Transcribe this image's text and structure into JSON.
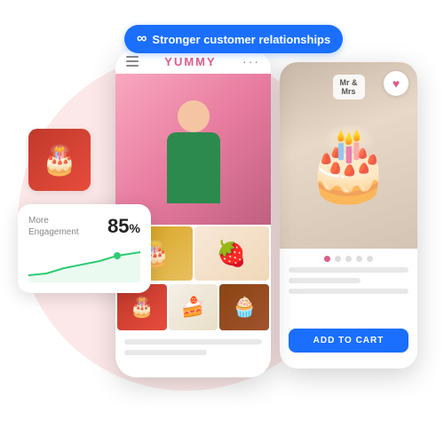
{
  "badge": {
    "icon": "∞",
    "label": "Stronger customer relationships"
  },
  "phone_main": {
    "brand": "YUMMY",
    "status_icon": "···"
  },
  "engagement_card": {
    "label": "More\nEngagement",
    "percent": "85",
    "percent_sign": "%"
  },
  "product_card": {
    "mr_mrs": "Mr&\nMrs",
    "dot_count": 5,
    "active_dot": 0,
    "add_to_cart": "ADD TO CART"
  },
  "colors": {
    "blue": "#1a6fff",
    "pink": "#e05c8a",
    "green": "#2ecc71",
    "bg_circle": "#fce8e8"
  }
}
